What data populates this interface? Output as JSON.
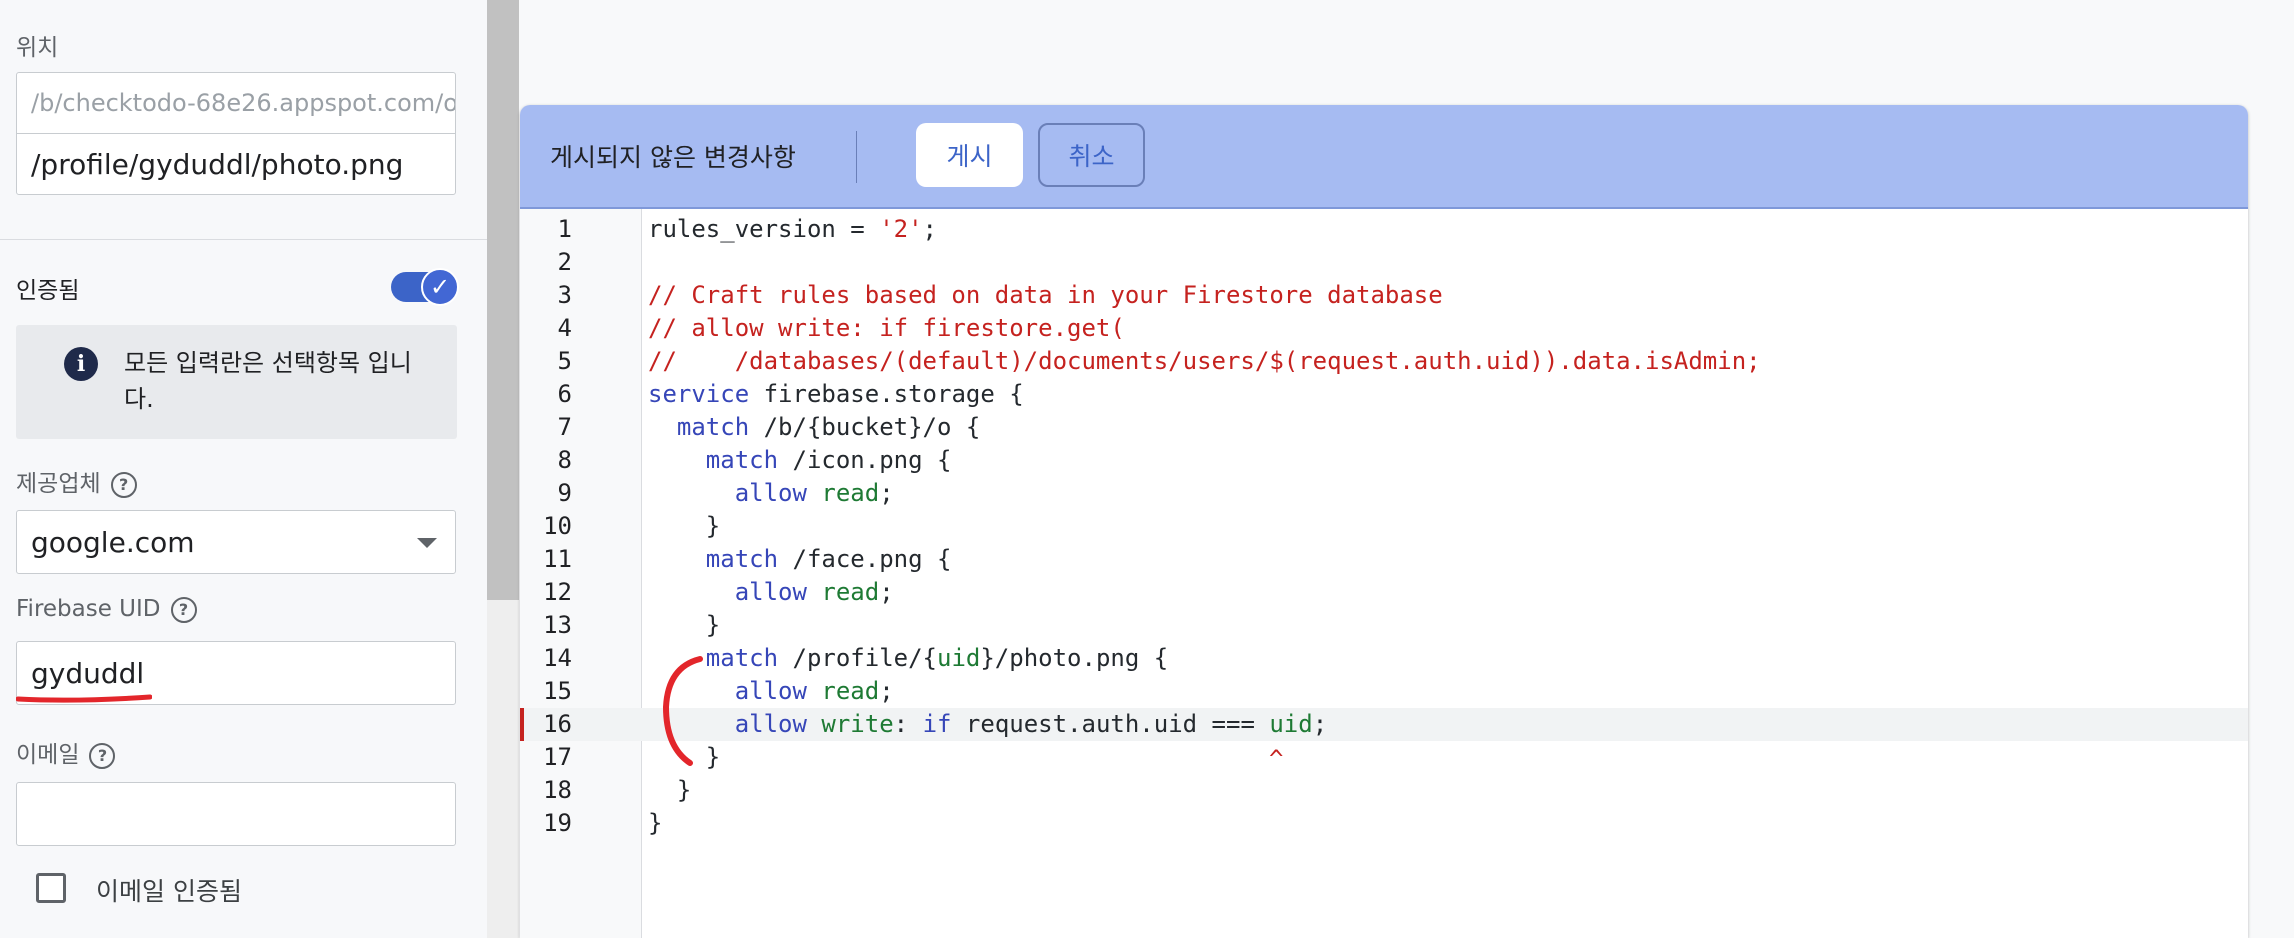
{
  "left_panel": {
    "location_label": "위치",
    "path_prefix": "/b/checktodo-68e26.appspot.com/o",
    "path_value": "/profile/gyduddl/photo.png",
    "authenticated_label": "인증됨",
    "authenticated_on": true,
    "info_text": "모든 입력란은 선택항목 입니다.",
    "provider_label": "제공업체",
    "provider_value": "google.com",
    "uid_label": "Firebase UID",
    "uid_value": "gyduddl",
    "email_label": "이메일",
    "email_value": "",
    "email_verified_label": "이메일 인증됨",
    "email_verified_checked": false
  },
  "editor": {
    "unpublished_label": "게시되지 않은 변경사항",
    "publish_label": "게시",
    "cancel_label": "취소",
    "error_line": 16,
    "lines": [
      "rules_version = '2';",
      "",
      "// Craft rules based on data in your Firestore database",
      "// allow write: if firestore.get(",
      "//    /databases/(default)/documents/users/$(request.auth.uid)).data.isAdmin;",
      "service firebase.storage {",
      "  match /b/{bucket}/o {",
      "    match /icon.png {",
      "      allow read;",
      "    }",
      "    match /face.png {",
      "      allow read;",
      "    }",
      "    match /profile/{uid}/photo.png {",
      "      allow read;",
      "      allow write: if request.auth.uid === uid;",
      "    }",
      "  }",
      "}"
    ],
    "caret_marker": "^"
  },
  "colors": {
    "header_bg": "#a6bbf2",
    "accent": "#3c64c8",
    "error": "#c5221f",
    "annotation": "#e3262b"
  }
}
